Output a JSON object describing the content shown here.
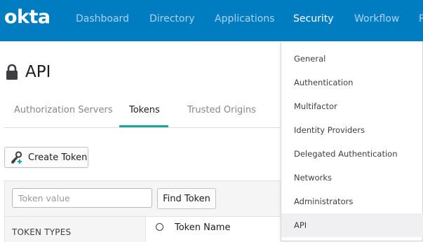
{
  "brand": {
    "logo_text": "okta",
    "nav_color": "#007dc1",
    "accent": "#1aa79a"
  },
  "nav": {
    "items": [
      {
        "label": "Dashboard"
      },
      {
        "label": "Directory"
      },
      {
        "label": "Applications"
      },
      {
        "label": "Security"
      },
      {
        "label": "Workflow"
      },
      {
        "label": "R"
      }
    ]
  },
  "page": {
    "icon": "lock-icon",
    "title": "API"
  },
  "tabs": [
    {
      "label": "Authorization Servers"
    },
    {
      "label": "Tokens"
    },
    {
      "label": "Trusted Origins"
    }
  ],
  "actions": {
    "create_label": "Create Token",
    "create_icon": "key-plus-icon"
  },
  "filter": {
    "input_placeholder": "Token value",
    "find_label": "Find Token",
    "token_types_label": "TOKEN TYPES",
    "column_header": "Token Name"
  },
  "security_menu": {
    "items": [
      {
        "label": "General"
      },
      {
        "label": "Authentication"
      },
      {
        "label": "Multifactor"
      },
      {
        "label": "Identity Providers"
      },
      {
        "label": "Delegated Authentication"
      },
      {
        "label": "Networks"
      },
      {
        "label": "Administrators"
      },
      {
        "label": "API"
      }
    ],
    "selected": "API"
  }
}
